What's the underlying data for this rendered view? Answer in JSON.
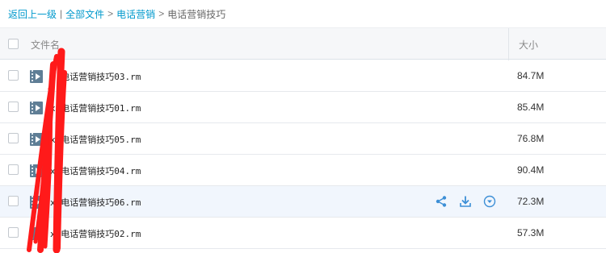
{
  "breadcrumb": {
    "back": "返回上一级",
    "divider": "|",
    "all_files": "全部文件",
    "arrow1": ">",
    "folder": "电话营销",
    "arrow2": ">",
    "current": "电话营销技巧"
  },
  "header": {
    "name_label": "文件名",
    "size_label": "大小"
  },
  "files": [
    {
      "name": "x-电话营销技巧03.rm",
      "size": "84.7M"
    },
    {
      "name": "x-电话营销技巧01.rm",
      "size": "85.4M"
    },
    {
      "name": "x-电话营销技巧05.rm",
      "size": "76.8M"
    },
    {
      "name": "x-电话营销技巧04.rm",
      "size": "90.4M"
    },
    {
      "name": "x-电话营销技巧06.rm",
      "size": "72.3M",
      "hovered": true
    },
    {
      "name": "x-电话营销技巧02.rm",
      "size": "57.3M"
    }
  ],
  "colors": {
    "link": "#0099cc",
    "hover_row": "#f1f6fd",
    "action_icon": "#3d8fd6",
    "scribble": "#ff0000"
  },
  "icons": [
    "video-file-icon",
    "share-icon",
    "download-icon",
    "more-dropdown-icon"
  ]
}
